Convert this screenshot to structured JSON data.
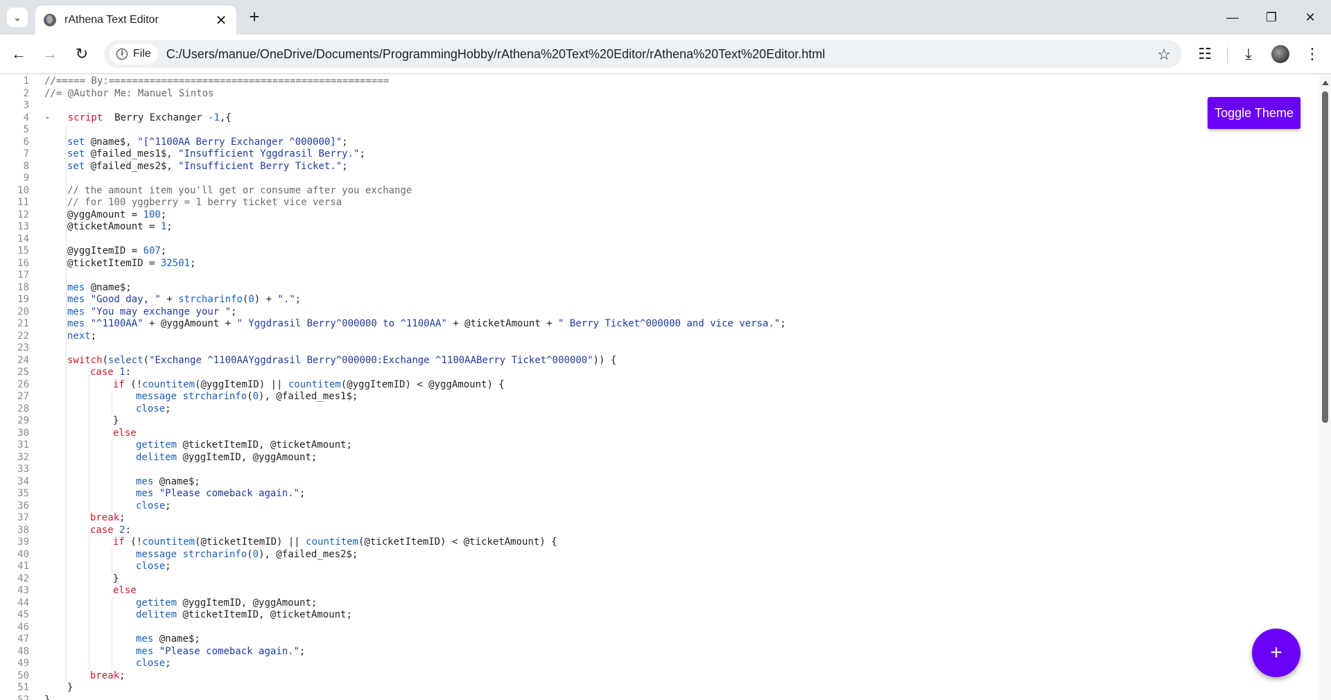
{
  "browser": {
    "tab_title": "rAthena Text Editor",
    "url_scheme_label": "File",
    "url": "C:/Users/manue/OneDrive/Documents/ProgrammingHobby/rAthena%20Text%20Editor/rAthena%20Text%20Editor.html"
  },
  "app": {
    "toggle_label": "Toggle Theme",
    "fab_label": "+",
    "accent_color": "#6a00f4"
  },
  "editor": {
    "font": "monospace",
    "lines": [
      {
        "n": "1",
        "indent": 0,
        "tokens": [
          [
            "cm",
            "//===== By:================================================"
          ]
        ]
      },
      {
        "n": "2",
        "indent": 0,
        "tokens": [
          [
            "cm",
            "//= @Author Me: Manuel Sintos"
          ]
        ]
      },
      {
        "n": "3",
        "indent": 0,
        "tokens": []
      },
      {
        "n": "4",
        "indent": 0,
        "fold": true,
        "tokens": [
          [
            "",
            "    "
          ],
          [
            "kw",
            "script"
          ],
          [
            "",
            "  Berry Exchanger "
          ],
          [
            "num",
            "-1"
          ],
          [
            "",
            ",{"
          ]
        ]
      },
      {
        "n": "5",
        "indent": 0,
        "tokens": []
      },
      {
        "n": "6",
        "indent": 1,
        "tokens": [
          [
            "fn",
            "set"
          ],
          [
            "",
            " @name$, "
          ],
          [
            "str",
            "\"[^1100AA Berry Exchanger ^000000]\""
          ],
          [
            "",
            ";"
          ]
        ]
      },
      {
        "n": "7",
        "indent": 1,
        "tokens": [
          [
            "fn",
            "set"
          ],
          [
            "",
            " @failed_mes1$, "
          ],
          [
            "str",
            "\"Insufficient Yggdrasil Berry.\""
          ],
          [
            "",
            ";"
          ]
        ]
      },
      {
        "n": "8",
        "indent": 1,
        "tokens": [
          [
            "fn",
            "set"
          ],
          [
            "",
            " @failed_mes2$, "
          ],
          [
            "str",
            "\"Insufficient Berry Ticket.\""
          ],
          [
            "",
            ";"
          ]
        ]
      },
      {
        "n": "9",
        "indent": 0,
        "tokens": []
      },
      {
        "n": "10",
        "indent": 1,
        "tokens": [
          [
            "cm",
            "// the amount item you'll get or consume after you exchange"
          ]
        ]
      },
      {
        "n": "11",
        "indent": 1,
        "tokens": [
          [
            "cm",
            "// for 100 yggberry = 1 berry ticket vice versa"
          ]
        ]
      },
      {
        "n": "12",
        "indent": 1,
        "tokens": [
          [
            "",
            "@yggAmount = "
          ],
          [
            "num",
            "100"
          ],
          [
            "",
            ";"
          ]
        ]
      },
      {
        "n": "13",
        "indent": 1,
        "tokens": [
          [
            "",
            "@ticketAmount = "
          ],
          [
            "num",
            "1"
          ],
          [
            "",
            ";"
          ]
        ]
      },
      {
        "n": "14",
        "indent": 0,
        "tokens": []
      },
      {
        "n": "15",
        "indent": 1,
        "tokens": [
          [
            "",
            "@yggItemID = "
          ],
          [
            "num",
            "607"
          ],
          [
            "",
            ";"
          ]
        ]
      },
      {
        "n": "16",
        "indent": 1,
        "tokens": [
          [
            "",
            "@ticketItemID = "
          ],
          [
            "num",
            "32501"
          ],
          [
            "",
            ";"
          ]
        ]
      },
      {
        "n": "17",
        "indent": 0,
        "tokens": []
      },
      {
        "n": "18",
        "indent": 1,
        "tokens": [
          [
            "fn",
            "mes"
          ],
          [
            "",
            " @name$;"
          ]
        ]
      },
      {
        "n": "19",
        "indent": 1,
        "tokens": [
          [
            "fn",
            "mes"
          ],
          [
            "",
            " "
          ],
          [
            "str",
            "\"Good day, \""
          ],
          [
            "",
            " + "
          ],
          [
            "fn",
            "strcharinfo"
          ],
          [
            "",
            "("
          ],
          [
            "num",
            "0"
          ],
          [
            "",
            ") + "
          ],
          [
            "str",
            "\".\""
          ],
          [
            "",
            ";"
          ]
        ]
      },
      {
        "n": "20",
        "indent": 1,
        "tokens": [
          [
            "fn",
            "mes"
          ],
          [
            "",
            " "
          ],
          [
            "str",
            "\"You may exchange your \""
          ],
          [
            "",
            ";"
          ]
        ]
      },
      {
        "n": "21",
        "indent": 1,
        "tokens": [
          [
            "fn",
            "mes"
          ],
          [
            "",
            " "
          ],
          [
            "str",
            "\"^1100AA\""
          ],
          [
            "",
            " + @yggAmount + "
          ],
          [
            "str",
            "\" Yggdrasil Berry^000000 to ^1100AA\""
          ],
          [
            "",
            " + @ticketAmount + "
          ],
          [
            "str",
            "\" Berry Ticket^000000 and vice versa.\""
          ],
          [
            "",
            ";"
          ]
        ]
      },
      {
        "n": "22",
        "indent": 1,
        "tokens": [
          [
            "fn",
            "next"
          ],
          [
            "",
            ";"
          ]
        ]
      },
      {
        "n": "23",
        "indent": 0,
        "tokens": []
      },
      {
        "n": "24",
        "indent": 1,
        "tokens": [
          [
            "kw",
            "switch"
          ],
          [
            "",
            "("
          ],
          [
            "fn",
            "select"
          ],
          [
            "",
            "("
          ],
          [
            "str",
            "\"Exchange ^1100AAYggdrasil Berry^000000:Exchange ^1100AABerry Ticket^000000\""
          ],
          [
            "",
            ")) {"
          ]
        ]
      },
      {
        "n": "25",
        "indent": 2,
        "tokens": [
          [
            "kw",
            "case"
          ],
          [
            "",
            " "
          ],
          [
            "num",
            "1"
          ],
          [
            "",
            ":"
          ]
        ]
      },
      {
        "n": "26",
        "indent": 3,
        "tokens": [
          [
            "kw",
            "if"
          ],
          [
            "",
            " (!"
          ],
          [
            "fn",
            "countitem"
          ],
          [
            "",
            "(@yggItemID) || "
          ],
          [
            "fn",
            "countitem"
          ],
          [
            "",
            "(@yggItemID) < @yggAmount) {"
          ]
        ]
      },
      {
        "n": "27",
        "indent": 4,
        "tokens": [
          [
            "fn",
            "message"
          ],
          [
            "",
            " "
          ],
          [
            "fn",
            "strcharinfo"
          ],
          [
            "",
            "("
          ],
          [
            "num",
            "0"
          ],
          [
            "",
            "), @failed_mes1$;"
          ]
        ]
      },
      {
        "n": "28",
        "indent": 4,
        "tokens": [
          [
            "fn",
            "close"
          ],
          [
            "",
            ";"
          ]
        ]
      },
      {
        "n": "29",
        "indent": 3,
        "tokens": [
          [
            "",
            "}"
          ]
        ]
      },
      {
        "n": "30",
        "indent": 3,
        "tokens": [
          [
            "kw",
            "else"
          ]
        ]
      },
      {
        "n": "31",
        "indent": 4,
        "tokens": [
          [
            "fn",
            "getitem"
          ],
          [
            "",
            " @ticketItemID, @ticketAmount;"
          ]
        ]
      },
      {
        "n": "32",
        "indent": 4,
        "tokens": [
          [
            "fn",
            "delitem"
          ],
          [
            "",
            " @yggItemID, @yggAmount;"
          ]
        ]
      },
      {
        "n": "33",
        "indent": 0,
        "tokens": []
      },
      {
        "n": "34",
        "indent": 4,
        "tokens": [
          [
            "fn",
            "mes"
          ],
          [
            "",
            " @name$;"
          ]
        ]
      },
      {
        "n": "35",
        "indent": 4,
        "tokens": [
          [
            "fn",
            "mes"
          ],
          [
            "",
            " "
          ],
          [
            "str",
            "\"Please comeback again.\""
          ],
          [
            "",
            ";"
          ]
        ]
      },
      {
        "n": "36",
        "indent": 4,
        "tokens": [
          [
            "fn",
            "close"
          ],
          [
            "",
            ";"
          ]
        ]
      },
      {
        "n": "37",
        "indent": 2,
        "tokens": [
          [
            "kw",
            "break"
          ],
          [
            "",
            ";"
          ]
        ]
      },
      {
        "n": "38",
        "indent": 2,
        "tokens": [
          [
            "kw",
            "case"
          ],
          [
            "",
            " "
          ],
          [
            "num",
            "2"
          ],
          [
            "",
            ":"
          ]
        ]
      },
      {
        "n": "39",
        "indent": 3,
        "tokens": [
          [
            "kw",
            "if"
          ],
          [
            "",
            " (!"
          ],
          [
            "fn",
            "countitem"
          ],
          [
            "",
            "(@ticketItemID) || "
          ],
          [
            "fn",
            "countitem"
          ],
          [
            "",
            "(@ticketItemID) < @ticketAmount) {"
          ]
        ]
      },
      {
        "n": "40",
        "indent": 4,
        "tokens": [
          [
            "fn",
            "message"
          ],
          [
            "",
            " "
          ],
          [
            "fn",
            "strcharinfo"
          ],
          [
            "",
            "("
          ],
          [
            "num",
            "0"
          ],
          [
            "",
            "), @failed_mes2$;"
          ]
        ]
      },
      {
        "n": "41",
        "indent": 4,
        "tokens": [
          [
            "fn",
            "close"
          ],
          [
            "",
            ";"
          ]
        ]
      },
      {
        "n": "42",
        "indent": 3,
        "tokens": [
          [
            "",
            "}"
          ]
        ]
      },
      {
        "n": "43",
        "indent": 3,
        "tokens": [
          [
            "kw",
            "else"
          ]
        ]
      },
      {
        "n": "44",
        "indent": 4,
        "tokens": [
          [
            "fn",
            "getitem"
          ],
          [
            "",
            " @yggItemID, @yggAmount;"
          ]
        ]
      },
      {
        "n": "45",
        "indent": 4,
        "tokens": [
          [
            "fn",
            "delitem"
          ],
          [
            "",
            " @ticketItemID, @ticketAmount;"
          ]
        ]
      },
      {
        "n": "46",
        "indent": 0,
        "tokens": []
      },
      {
        "n": "47",
        "indent": 4,
        "tokens": [
          [
            "fn",
            "mes"
          ],
          [
            "",
            " @name$;"
          ]
        ]
      },
      {
        "n": "48",
        "indent": 4,
        "tokens": [
          [
            "fn",
            "mes"
          ],
          [
            "",
            " "
          ],
          [
            "str",
            "\"Please comeback again.\""
          ],
          [
            "",
            ";"
          ]
        ]
      },
      {
        "n": "49",
        "indent": 4,
        "tokens": [
          [
            "fn",
            "close"
          ],
          [
            "",
            ";"
          ]
        ]
      },
      {
        "n": "50",
        "indent": 2,
        "tokens": [
          [
            "kw",
            "break"
          ],
          [
            "",
            ";"
          ]
        ]
      },
      {
        "n": "51",
        "indent": 1,
        "tokens": [
          [
            "",
            "}"
          ]
        ]
      },
      {
        "n": "52",
        "indent": 0,
        "tokens": [
          [
            "",
            "}"
          ]
        ]
      }
    ]
  }
}
